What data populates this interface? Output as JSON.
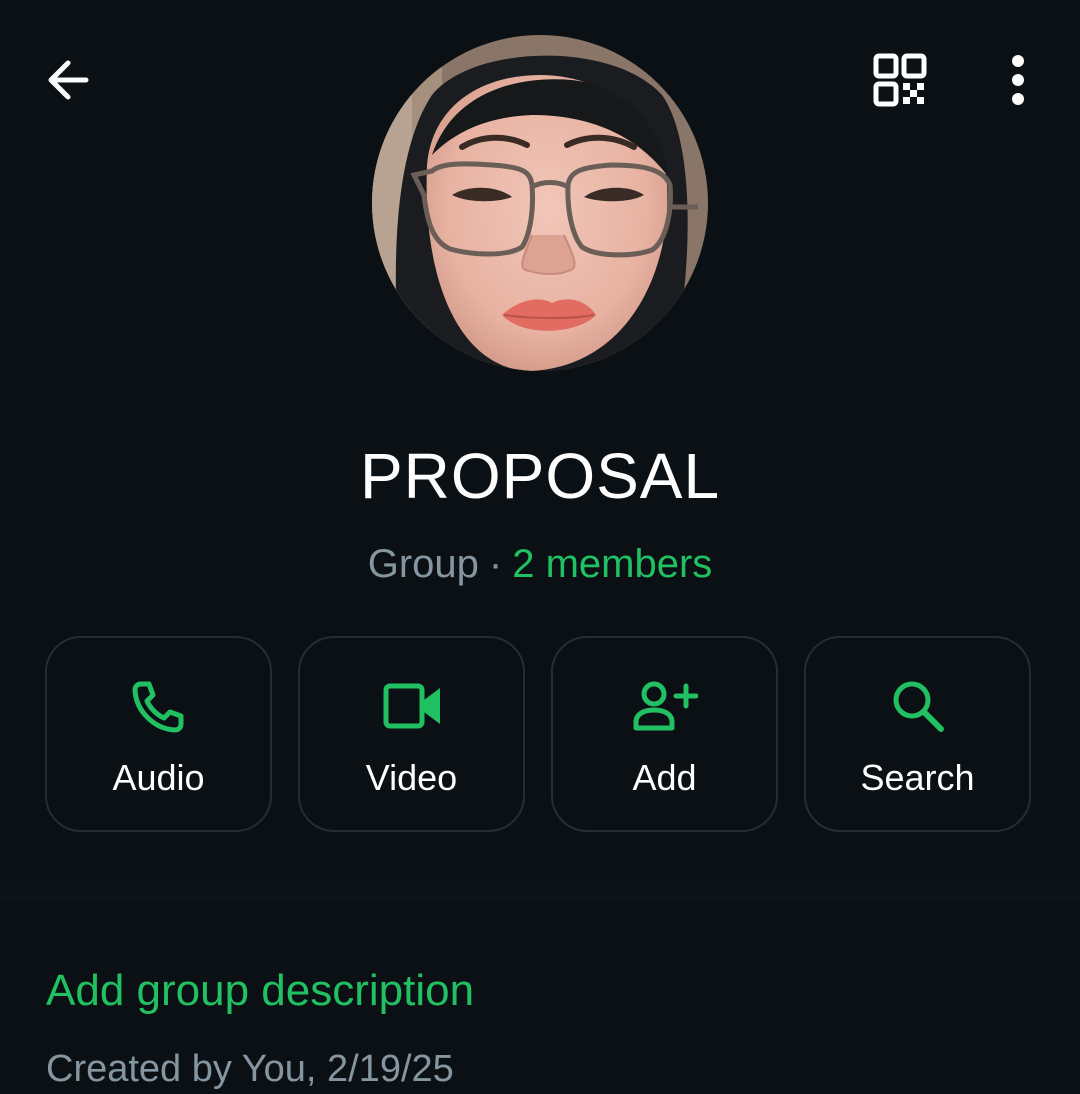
{
  "header": {
    "back_icon": "arrow-left-icon",
    "qr_icon": "qr-code-icon",
    "more_icon": "more-vertical-icon"
  },
  "group": {
    "name": "PROPOSAL",
    "type_label": "Group",
    "separator": "·",
    "members_label": "2 members"
  },
  "actions": [
    {
      "label": "Audio",
      "icon": "phone-icon"
    },
    {
      "label": "Video",
      "icon": "video-camera-icon"
    },
    {
      "label": "Add",
      "icon": "add-person-icon"
    },
    {
      "label": "Search",
      "icon": "search-icon"
    }
  ],
  "description": {
    "add_label": "Add group description",
    "created_text": "Created by You, 2/19/25"
  },
  "colors": {
    "background": "#0b1014",
    "accent": "#21c063",
    "secondary_text": "#8696a0",
    "card_border": "#262d31"
  }
}
